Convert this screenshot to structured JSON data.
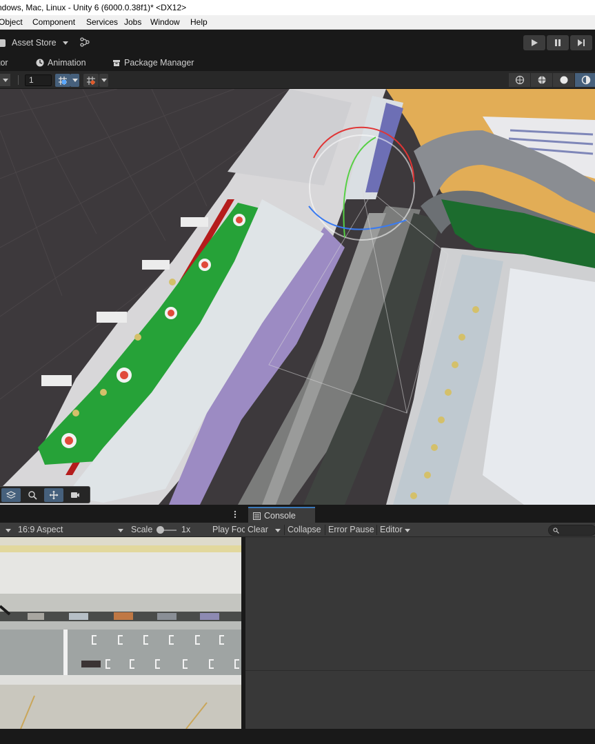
{
  "title_bar": {
    "text": "ndows, Mac, Linux - Unity 6 (6000.0.38f1)* <DX12>"
  },
  "menu": {
    "items": [
      {
        "label": "Object"
      },
      {
        "label": "Component"
      },
      {
        "label": "Services"
      },
      {
        "label": "Jobs"
      },
      {
        "label": "Window"
      },
      {
        "label": "Help"
      }
    ]
  },
  "toolbar": {
    "asset_store_label": "Asset Store",
    "icons": [
      "shopping-bag-icon",
      "version-control-icon",
      "play-icon",
      "pause-icon",
      "step-icon"
    ]
  },
  "tabs": [
    {
      "label": "tor"
    },
    {
      "label": "Animation",
      "icon": "animation-icon"
    },
    {
      "label": "Package Manager",
      "icon": "package-icon"
    }
  ],
  "scene_toolbar": {
    "grid_size": "1",
    "icons": [
      "grid-snap-icon",
      "increment-snap-icon",
      "wireframe-icon",
      "shaded-wireframe-icon",
      "shaded-icon",
      "unlit-icon"
    ]
  },
  "overlay_tools": {
    "icons": [
      "layers-icon",
      "search-icon",
      "move-tool-icon",
      "camera-icon"
    ]
  },
  "console": {
    "tab_label": "Console",
    "toolbar": {
      "clear": "Clear",
      "collapse": "Collapse",
      "error_pause": "Error Pause",
      "editor": "Editor"
    }
  },
  "game_view": {
    "aspect": "16:9 Aspect",
    "scale_label": "Scale",
    "scale_value": "1x",
    "play_focus": "Play Foc"
  },
  "colors": {
    "accent_blue": "#3a79bb",
    "active_button": "#46607c",
    "editor_dark": "#191919",
    "panel_gray": "#3c3c3c",
    "console_bg": "#383838"
  }
}
